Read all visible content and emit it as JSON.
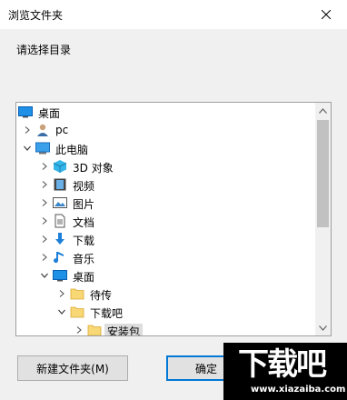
{
  "window": {
    "title": "浏览文件夹"
  },
  "prompt": "请选择目录",
  "tree": {
    "items": [
      {
        "label": "桌面",
        "icon": "desktop-icon",
        "expander": "none",
        "level": 0
      },
      {
        "label": "pc",
        "icon": "user-folder-icon",
        "expander": "collapsed",
        "level": 1
      },
      {
        "label": "此电脑",
        "icon": "computer-icon",
        "expander": "expanded",
        "level": 1
      },
      {
        "label": "3D 对象",
        "icon": "3d-objects-icon",
        "expander": "collapsed",
        "level": 2
      },
      {
        "label": "视频",
        "icon": "videos-icon",
        "expander": "collapsed",
        "level": 2
      },
      {
        "label": "图片",
        "icon": "pictures-icon",
        "expander": "collapsed",
        "level": 2
      },
      {
        "label": "文档",
        "icon": "documents-icon",
        "expander": "collapsed",
        "level": 2
      },
      {
        "label": "下载",
        "icon": "downloads-icon",
        "expander": "collapsed",
        "level": 2
      },
      {
        "label": "音乐",
        "icon": "music-icon",
        "expander": "collapsed",
        "level": 2
      },
      {
        "label": "桌面",
        "icon": "desktop-icon",
        "expander": "expanded",
        "level": 2
      },
      {
        "label": "待传",
        "icon": "folder-icon",
        "expander": "collapsed",
        "level": 3
      },
      {
        "label": "下载吧",
        "icon": "folder-icon",
        "expander": "expanded",
        "level": 3
      },
      {
        "label": "安装包",
        "icon": "folder-icon",
        "expander": "collapsed",
        "level": 4,
        "selected": true
      }
    ]
  },
  "buttons": {
    "new_folder": "新建文件夹(M)",
    "ok": "确定"
  },
  "watermark": {
    "logo": "下载吧",
    "url": "www.xiazaiba.com"
  },
  "colors": {
    "accent": "#0078d7",
    "folder": "#f8d775",
    "selection": "#dddddd"
  }
}
